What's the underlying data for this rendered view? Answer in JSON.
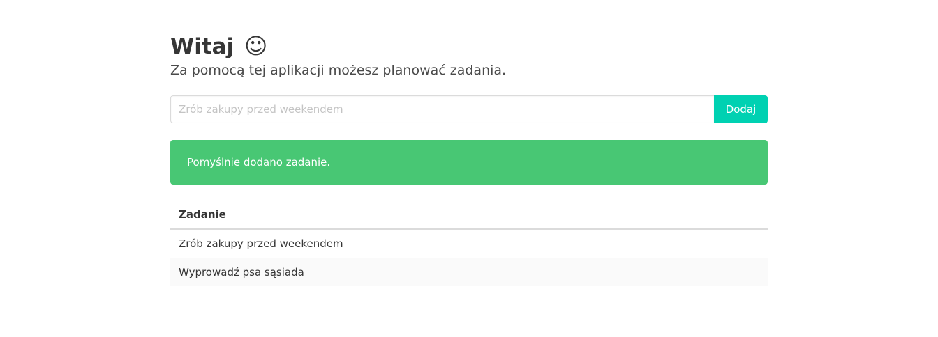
{
  "header": {
    "title": "Witaj",
    "emoji": "☺",
    "subtitle": "Za pomocą tej aplikacji możesz planować zadania."
  },
  "form": {
    "input_value": "",
    "input_placeholder": "Zrób zakupy przed weekendem",
    "add_label": "Dodaj"
  },
  "notification": {
    "message": "Pomyślnie dodano zadanie.",
    "color": "#48c774"
  },
  "table": {
    "headers": [
      "Zadanie"
    ],
    "rows": [
      {
        "task": "Zrób zakupy przed weekendem"
      },
      {
        "task": "Wyprowadź psa sąsiada"
      }
    ]
  },
  "colors": {
    "accent": "#00d1b2",
    "success": "#48c774"
  }
}
